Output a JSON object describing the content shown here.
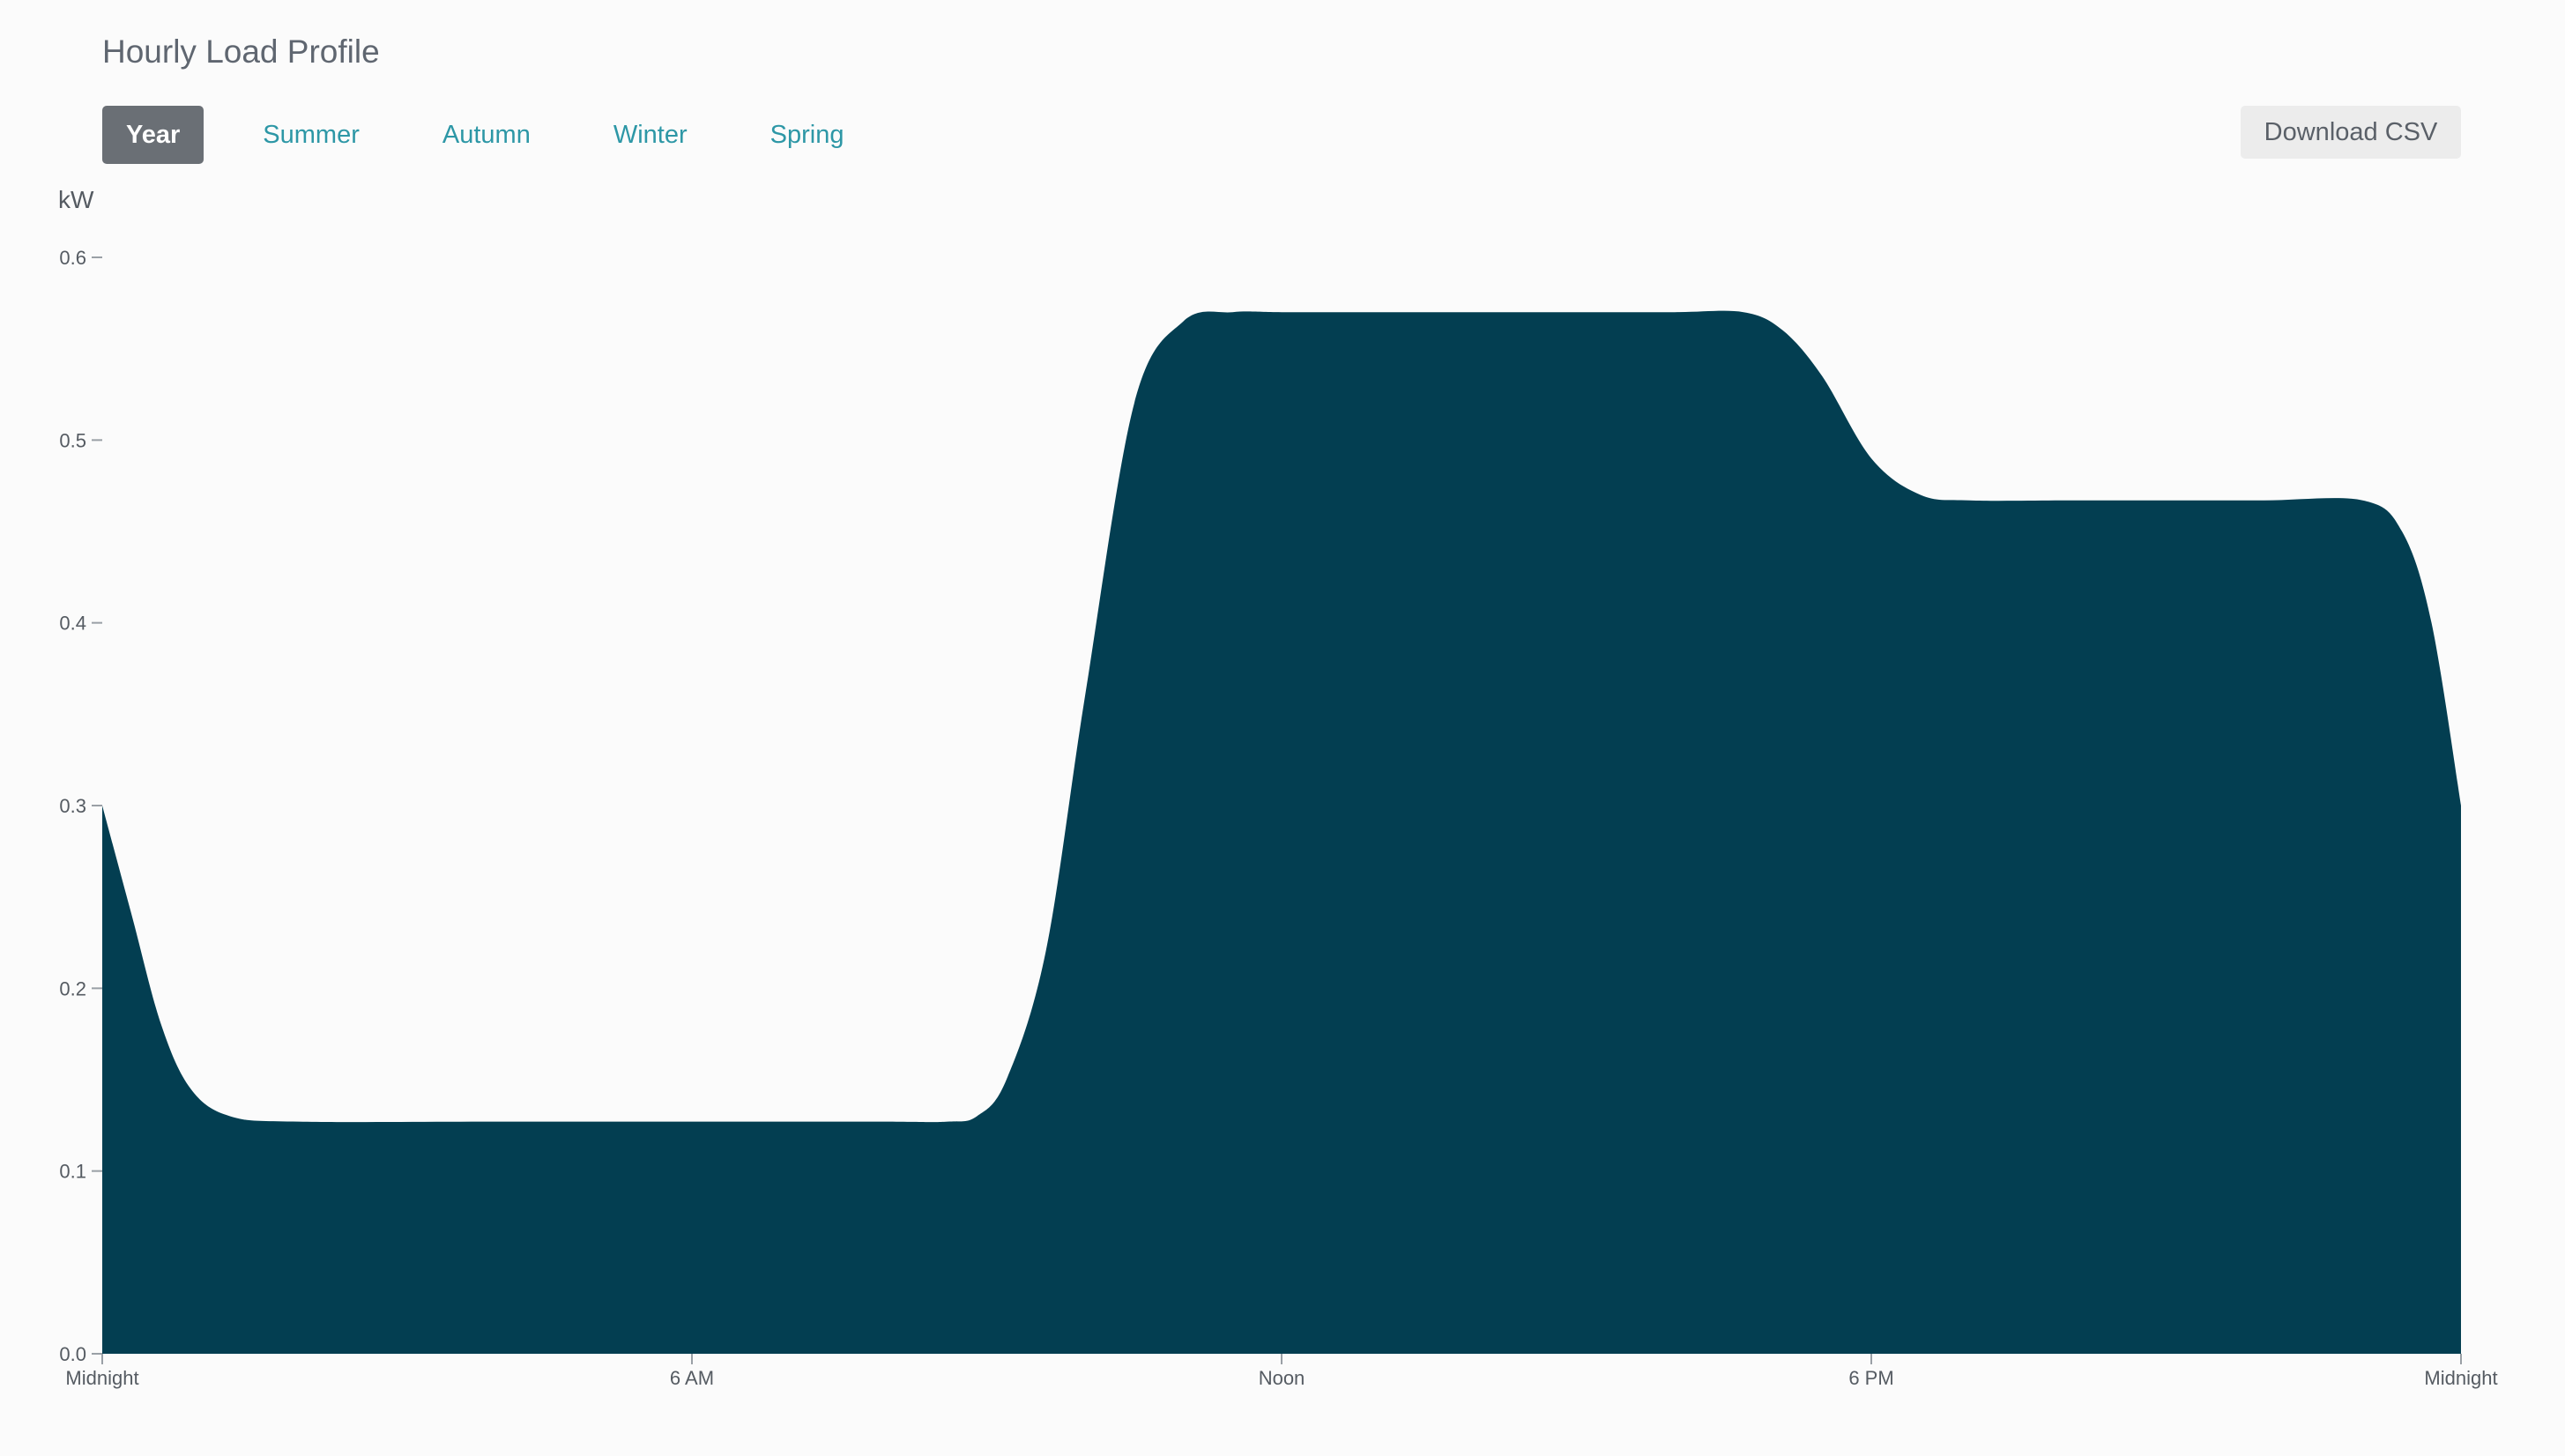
{
  "header": {
    "title": "Hourly Load Profile",
    "download_label": "Download CSV"
  },
  "tabs": [
    {
      "label": "Year",
      "active": true
    },
    {
      "label": "Summer",
      "active": false
    },
    {
      "label": "Autumn",
      "active": false
    },
    {
      "label": "Winter",
      "active": false
    },
    {
      "label": "Spring",
      "active": false
    }
  ],
  "colors": {
    "area": "#033e51",
    "accent": "#2d97a6",
    "active_tab": "#6a6f75",
    "axis": "#9aa0a6"
  },
  "chart_data": {
    "type": "area",
    "title": "",
    "xlabel": "",
    "ylabel": "kW",
    "xlim": [
      0,
      24
    ],
    "ylim": [
      0,
      0.6
    ],
    "grid": false,
    "legend": "none",
    "y_ticks": [
      "0.0",
      "0.1",
      "0.2",
      "0.3",
      "0.4",
      "0.5",
      "0.6"
    ],
    "y_tick_values": [
      0,
      0.1,
      0.2,
      0.3,
      0.4,
      0.5,
      0.6
    ],
    "x_ticks": [
      "Midnight",
      "6 AM",
      "Noon",
      "6 PM",
      "Midnight"
    ],
    "x_tick_values": [
      0,
      6,
      12,
      18,
      24
    ],
    "series": [
      {
        "x": [
          0,
          0.3,
          0.6,
          0.9,
          1.3,
          2,
          4,
          6,
          8,
          8.6,
          8.9,
          9.2,
          9.6,
          10,
          10.5,
          11,
          11.5,
          12,
          13,
          14,
          15,
          16,
          16.7,
          17.1,
          17.5,
          18,
          18.5,
          19,
          20,
          21,
          22,
          23,
          23.4,
          23.7,
          24
        ],
        "values": [
          0.3,
          0.24,
          0.18,
          0.145,
          0.13,
          0.127,
          0.127,
          0.127,
          0.127,
          0.127,
          0.13,
          0.15,
          0.22,
          0.36,
          0.52,
          0.565,
          0.57,
          0.57,
          0.57,
          0.57,
          0.57,
          0.57,
          0.57,
          0.56,
          0.535,
          0.49,
          0.47,
          0.467,
          0.467,
          0.467,
          0.467,
          0.467,
          0.45,
          0.4,
          0.3
        ]
      }
    ]
  }
}
